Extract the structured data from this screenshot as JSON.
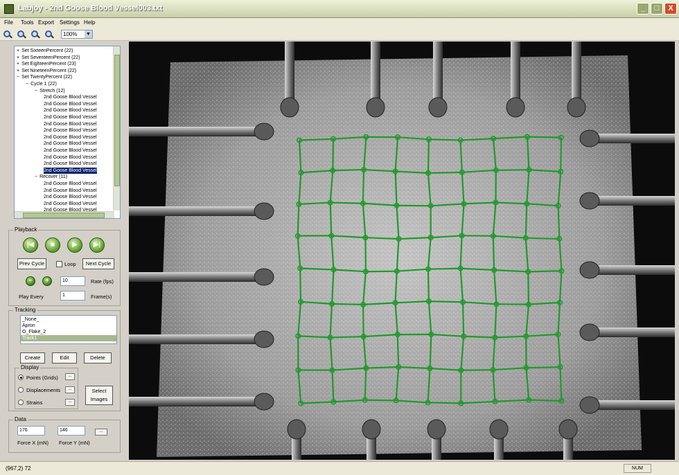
{
  "window": {
    "title": "Labjoy - 2nd Goose Blood Vessel003.txt",
    "minimize": "_",
    "maximize": "□",
    "close": "X"
  },
  "menu": [
    "File",
    "Tools",
    "Export",
    "Settings",
    "Help"
  ],
  "toolbar": {
    "zoom_buttons": [
      "zoom-out-icon",
      "zoom-fit-icon",
      "zoom-in-icon",
      "zoom-actual-icon"
    ],
    "zoom_level": "100%"
  },
  "tree": {
    "items": [
      {
        "expander": "+",
        "label": "Set SixteenPercent (22)",
        "indent": 0
      },
      {
        "expander": "+",
        "label": "Set SeventeenPercent (22)",
        "indent": 0
      },
      {
        "expander": "+",
        "label": "Set EighteenPercent (23)",
        "indent": 0
      },
      {
        "expander": "+",
        "label": "Set NineteenPercent (22)",
        "indent": 0
      },
      {
        "expander": "−",
        "label": "Set TwentyPercent (22)",
        "indent": 0
      },
      {
        "expander": "−",
        "label": "Cycle 1 (22)",
        "indent": 1
      },
      {
        "expander": "−",
        "label": "Stretch (12)",
        "indent": 2
      },
      {
        "expander": "",
        "label": "2nd Goose Blood Vessel",
        "indent": 3
      },
      {
        "expander": "",
        "label": "2nd Goose Blood Vessel",
        "indent": 3
      },
      {
        "expander": "",
        "label": "2nd Goose Blood Vessel",
        "indent": 3
      },
      {
        "expander": "",
        "label": "2nd Goose Blood Vessel",
        "indent": 3
      },
      {
        "expander": "",
        "label": "2nd Goose Blood Vessel",
        "indent": 3
      },
      {
        "expander": "",
        "label": "2nd Goose Blood Vessel",
        "indent": 3
      },
      {
        "expander": "",
        "label": "2nd Goose Blood Vessel",
        "indent": 3
      },
      {
        "expander": "",
        "label": "2nd Goose Blood Vessel",
        "indent": 3
      },
      {
        "expander": "",
        "label": "2nd Goose Blood Vessel",
        "indent": 3
      },
      {
        "expander": "",
        "label": "2nd Goose Blood Vessel",
        "indent": 3
      },
      {
        "expander": "",
        "label": "2nd Goose Blood Vessel",
        "indent": 3
      },
      {
        "expander": "",
        "label": "2nd Goose Blood Vessel",
        "indent": 3,
        "selected": true
      },
      {
        "expander": "−",
        "label": "Recover (11)",
        "indent": 2
      },
      {
        "expander": "",
        "label": "2nd Goose Blood Vessel",
        "indent": 3
      },
      {
        "expander": "",
        "label": "2nd Goose Blood Vessel",
        "indent": 3
      },
      {
        "expander": "",
        "label": "2nd Goose Blood Vessel",
        "indent": 3
      },
      {
        "expander": "",
        "label": "2nd Goose Blood Vessel",
        "indent": 3
      },
      {
        "expander": "",
        "label": "2nd Goose Blood Vessel",
        "indent": 3
      },
      {
        "expander": "",
        "label": "2nd Goose Blood Vessel",
        "indent": 3
      },
      {
        "expander": "",
        "label": "2nd Goose Blood Vessel",
        "indent": 3
      }
    ]
  },
  "playback": {
    "group_label": "Playback",
    "prev_cycle": "Prev Cycle",
    "loop_label": "Loop",
    "next_cycle": "Next Cycle",
    "rate_value": "10",
    "rate_label": "Rate (fps)",
    "play_every_label": "Play Every",
    "play_every_value": "1",
    "frames_label": "Frame(s)",
    "minus": "−",
    "plus": "+"
  },
  "tracking": {
    "group_label": "Tracking",
    "items": [
      "_None_",
      "Apron",
      "O_Flake_2",
      "Track1"
    ],
    "selected_index": 3,
    "create": "Create",
    "edit": "Edit",
    "delete": "Delete",
    "display_label": "Display",
    "points_label": "Points (Grids)",
    "displacements_label": "Displacements",
    "strains_label": "Strains",
    "select_images_line1": "Select",
    "select_images_line2": "Images",
    "ellipsis": "..."
  },
  "data": {
    "group_label": "Data",
    "force_x_value": "176",
    "force_x_label": "Force X (mN)",
    "force_y_value": "146",
    "force_y_label": "Force Y (mN)",
    "ellipsis": "..."
  },
  "status": {
    "coords": "(967,2)  72",
    "num": "NUM"
  },
  "colors": {
    "grid": "#1f9a2a",
    "selection": "#0a246a"
  }
}
